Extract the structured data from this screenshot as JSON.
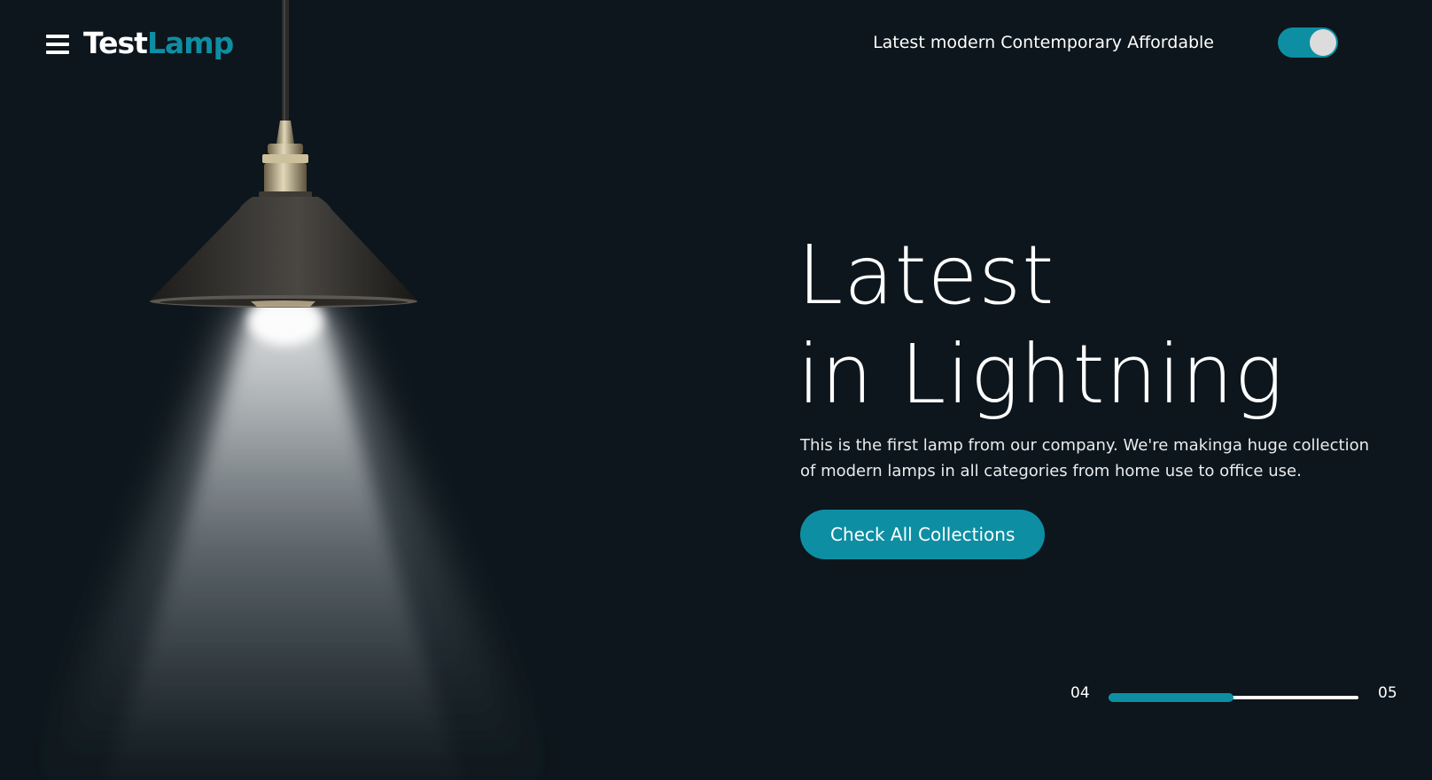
{
  "header": {
    "logo_part1": "Test",
    "logo_part2": "Lamp",
    "tagline": "Latest modern Contemporary Affordable",
    "toggle_on": true,
    "menu_icon": "hamburger-menu-icon"
  },
  "hero": {
    "title_line1": "Latest",
    "title_line2": "in Lightning",
    "description": "This is the first lamp from our company. We're makinga huge collection of modern lamps in all categories from home use to office use.",
    "cta_label": "Check All Collections"
  },
  "slider": {
    "current": "04",
    "total": "05",
    "progress": 0.5
  },
  "colors": {
    "background": "#0d161c",
    "accent": "#0e8ea3",
    "text": "#ffffff",
    "toggle_knob": "#dcdcdc"
  }
}
